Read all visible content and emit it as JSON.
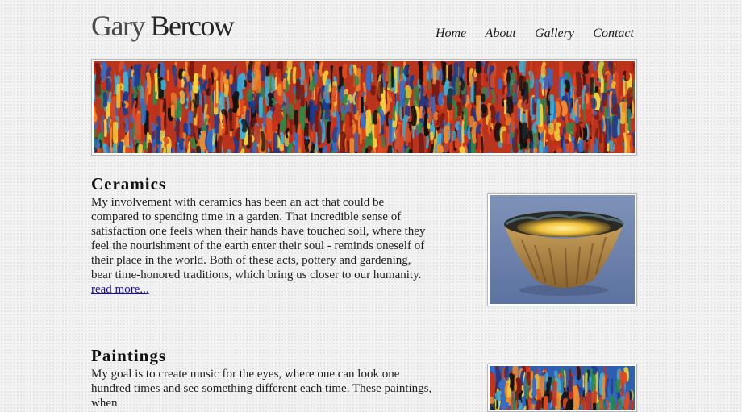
{
  "header": {
    "title_first": "Gary",
    "title_last": "Bercow",
    "nav": [
      "Home",
      "About",
      "Gallery",
      "Contact"
    ]
  },
  "sections": [
    {
      "heading": "Ceramics",
      "text": "My involvement with ceramics has been an act that could be compared to spending time in a garden. That incredible sense of satisfaction one feels when their hands have touched soil, where they feel the nourishment of the earth enter their soul - reminds oneself of their place in the world. Both of these acts, pottery and gardening, bear time-honored traditions, which bring us closer to our humanity.",
      "link": "read more..."
    },
    {
      "heading": "Paintings",
      "text": "My goal is to create music for the eyes, where one can look one hundred times and see something different each time. These paintings, when"
    }
  ],
  "colors": {
    "link": "#1a0dab",
    "text": "#1f1f1f",
    "banner_palette": [
      "#c8321b",
      "#e04a1f",
      "#f08a2a",
      "#f4d23a",
      "#2f6fd0",
      "#1b3c8f",
      "#3ab0d8",
      "#2b8a4a",
      "#7a1a12",
      "#111111"
    ]
  }
}
